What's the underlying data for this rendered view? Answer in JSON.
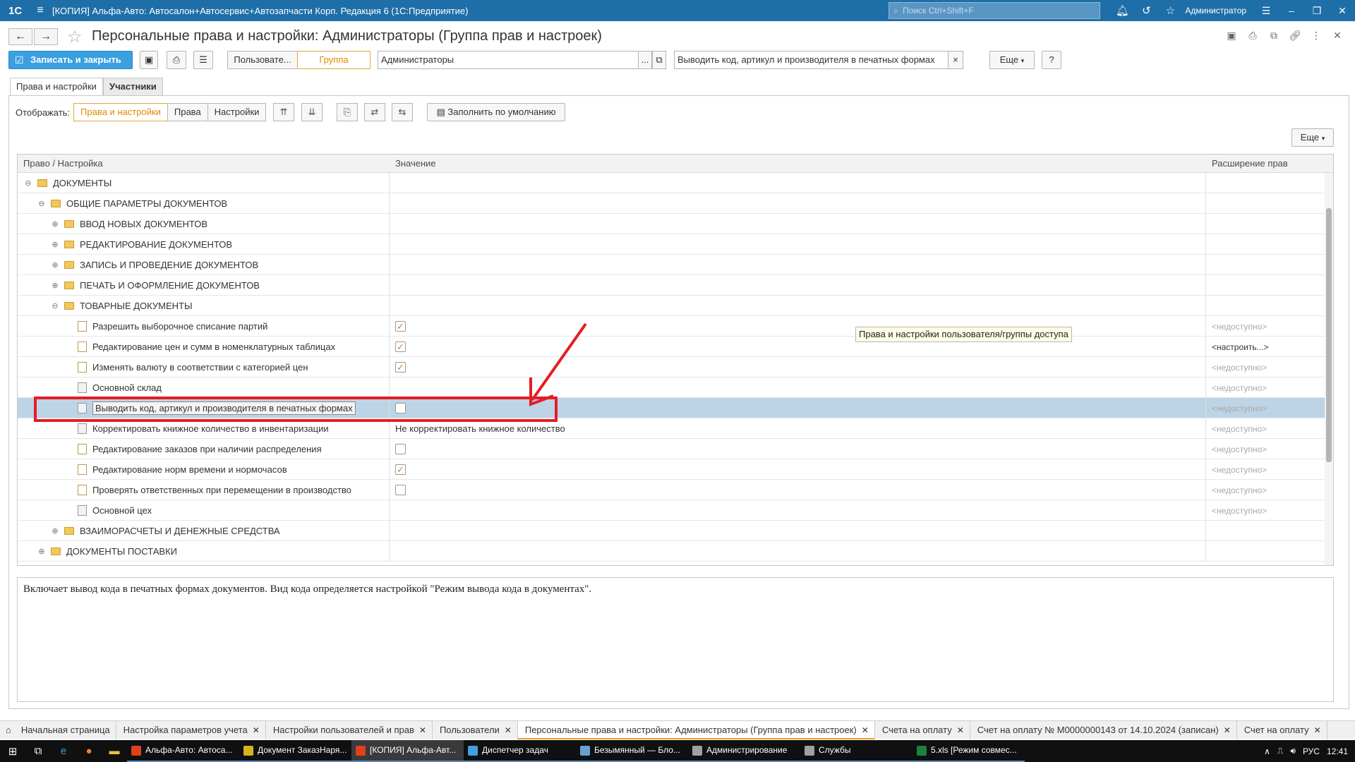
{
  "titlebar": {
    "logo": "1С",
    "title": "[КОПИЯ] Альфа-Авто: Автосалон+Автосервис+Автозапчасти Корп. Редакция 6  (1С:Предприятие)",
    "search_placeholder": "Поиск Ctrl+Shift+F",
    "user": "Администратор"
  },
  "header": {
    "title": "Персональные права и настройки: Администраторы (Группа прав и настроек)"
  },
  "toolbar": {
    "save_close": "Записать и закрыть",
    "mode_user": "Пользовате...",
    "mode_group": "Группа",
    "group_value": "Администраторы",
    "group_select": "...",
    "search_value": "Выводить код, артикул и производителя в печатных формах",
    "clear": "×",
    "more": "Еще",
    "help": "?"
  },
  "tabs": [
    {
      "label": "Права и настройки"
    },
    {
      "label": "Участники"
    }
  ],
  "showbar": {
    "label": "Отображать:",
    "options": [
      "Права и настройки",
      "Права",
      "Настройки"
    ],
    "fill_default": "Заполнить по умолчанию",
    "more": "Еще"
  },
  "grid": {
    "columns": [
      "Право / Настройка",
      "Значение",
      "Расширение прав"
    ],
    "rows": [
      {
        "level": 0,
        "type": "folder",
        "toggle": "⊖",
        "name": "ДОКУМЕНТЫ",
        "value": "",
        "ext": ""
      },
      {
        "level": 1,
        "type": "folder",
        "toggle": "⊖",
        "name": "ОБЩИЕ ПАРАМЕТРЫ ДОКУМЕНТОВ",
        "value": "",
        "ext": ""
      },
      {
        "level": 2,
        "type": "folder",
        "toggle": "⊕",
        "name": "ВВОД НОВЫХ ДОКУМЕНТОВ",
        "value": "",
        "ext": ""
      },
      {
        "level": 2,
        "type": "folder",
        "toggle": "⊕",
        "name": "РЕДАКТИРОВАНИЕ ДОКУМЕНТОВ",
        "value": "",
        "ext": ""
      },
      {
        "level": 2,
        "type": "folder",
        "toggle": "⊕",
        "name": "ЗАПИСЬ И ПРОВЕДЕНИЕ ДОКУМЕНТОВ",
        "value": "",
        "ext": ""
      },
      {
        "level": 2,
        "type": "folder",
        "toggle": "⊕",
        "name": "ПЕЧАТЬ И ОФОРМЛЕНИЕ ДОКУМЕНТОВ",
        "value": "",
        "ext": ""
      },
      {
        "level": 2,
        "type": "folder",
        "toggle": "⊖",
        "name": "ТОВАРНЫЕ ДОКУМЕНТЫ",
        "value": "",
        "ext": ""
      },
      {
        "level": 3,
        "type": "right",
        "name": "Разрешить выборочное списание партий",
        "check": true,
        "value": "",
        "ext": "<недоступно>"
      },
      {
        "level": 3,
        "type": "right",
        "name": "Редактирование цен и сумм в номенклатурных таблицах",
        "check": true,
        "value": "",
        "ext": "<настроить...>"
      },
      {
        "level": 3,
        "type": "right",
        "name": "Изменять валюту в соответствии с категорией цен",
        "check": true,
        "value": "",
        "ext": "<недоступно>"
      },
      {
        "level": 3,
        "type": "setting",
        "name": "Основной склад",
        "value": "",
        "ext": "<недоступно>"
      },
      {
        "level": 3,
        "type": "setting",
        "name": "Выводить код, артикул и производителя в печатных формах",
        "check": false,
        "value": "",
        "ext": "<недоступно>",
        "selected": true
      },
      {
        "level": 3,
        "type": "setting",
        "name": "Корректировать книжное количество в инвентаризации",
        "value": "Не корректировать книжное количество",
        "ext": "<недоступно>"
      },
      {
        "level": 3,
        "type": "right",
        "name": "Редактирование заказов при наличии распределения",
        "check": false,
        "value": "",
        "ext": "<недоступно>"
      },
      {
        "level": 3,
        "type": "right",
        "name": "Редактирование норм времени и нормочасов",
        "check": true,
        "value": "",
        "ext": "<недоступно>"
      },
      {
        "level": 3,
        "type": "right",
        "name": "Проверять ответственных при перемещении в производство",
        "check": false,
        "value": "",
        "ext": "<недоступно>"
      },
      {
        "level": 3,
        "type": "setting",
        "name": "Основной цех",
        "value": "",
        "ext": "<недоступно>"
      },
      {
        "level": 2,
        "type": "folder",
        "toggle": "⊕",
        "name": "ВЗАИМОРАСЧЕТЫ И ДЕНЕЖНЫЕ СРЕДСТВА",
        "value": "",
        "ext": ""
      },
      {
        "level": 1,
        "type": "folder",
        "toggle": "⊕",
        "name": "ДОКУМЕНТЫ ПОСТАВКИ",
        "value": "",
        "ext": ""
      }
    ]
  },
  "tooltip": "Права и настройки пользователя/группы доступа",
  "description": "Включает вывод кода в печатных формах документов. Вид кода определяется настройкой \"Режим вывода кода в документах\".",
  "window_tabs": [
    {
      "label": "Начальная страница",
      "closable": false
    },
    {
      "label": "Настройка параметров учета",
      "closable": true
    },
    {
      "label": "Настройки пользователей и прав",
      "closable": true
    },
    {
      "label": "Пользователи",
      "closable": true
    },
    {
      "label": "Персональные права и настройки: Администраторы (Группа прав и настроек)",
      "closable": true,
      "active": true
    },
    {
      "label": "Счета на оплату",
      "closable": true
    },
    {
      "label": "Счет на оплату № М0000000143 от 14.10.2024 (записан)",
      "closable": true
    },
    {
      "label": "Счет на оплату",
      "closable": true
    }
  ],
  "taskbar": {
    "apps": [
      {
        "label": "Альфа-Авто: Автоса...",
        "color": "#e04020"
      },
      {
        "label": "Документ ЗаказНаря...",
        "color": "#d8b020"
      },
      {
        "label": "[КОПИЯ] Альфа-Авт...",
        "color": "#e04020",
        "active": true
      },
      {
        "label": "Диспетчер задач",
        "color": "#40a0e0"
      },
      {
        "label": "Безымянный — Бло...",
        "color": "#6aa0d0"
      },
      {
        "label": "Администрирование",
        "color": "#a0a0a0"
      },
      {
        "label": "Службы",
        "color": "#a0a0a0"
      },
      {
        "label": "5.xls  [Режим совмес...",
        "color": "#1e8040"
      }
    ],
    "lang": "РУС",
    "time": "12:41"
  },
  "colors": {
    "titlebar": "#1e6fa8",
    "primary_button": "#3aa0e0",
    "selected_row": "#bcd4e6",
    "highlight_box": "#e51d24",
    "checkbox_mark": "#e07a1a"
  }
}
